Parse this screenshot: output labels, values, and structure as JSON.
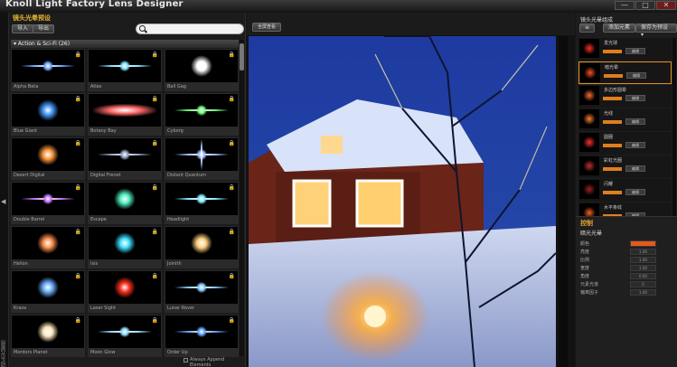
{
  "window": {
    "title": "Knoll Light Factory Lens Designer",
    "min_label": "—",
    "max_label": "□",
    "close_label": "✕"
  },
  "left_tab": {
    "label": "镜头光晕预设"
  },
  "library": {
    "title": "镜头光晕预设",
    "import_label": "导入",
    "export_label": "导出",
    "category": "▾ Action & Sci-Fi (26)",
    "append_label": "Always Append Elements",
    "presets": [
      {
        "name": "Alpha Beta",
        "color": "#6fa8ff",
        "style": "streak"
      },
      {
        "name": "Atlas",
        "color": "#7fe0ff",
        "style": "streak"
      },
      {
        "name": "Ball Gag",
        "color": "#ffffff",
        "style": "orb"
      },
      {
        "name": "Blue Giant",
        "color": "#4a9aff",
        "style": "orb"
      },
      {
        "name": "Botany Bay",
        "color": "#ff6a6a",
        "style": "bar"
      },
      {
        "name": "Cyborg",
        "color": "#6bff7a",
        "style": "streak"
      },
      {
        "name": "Desert Digital",
        "color": "#ff9a40",
        "style": "orb"
      },
      {
        "name": "Digital Frenet",
        "color": "#8fa0c0",
        "style": "streak"
      },
      {
        "name": "Distant Quantum",
        "color": "#9fb8ff",
        "style": "star"
      },
      {
        "name": "Double Barrel",
        "color": "#c070ff",
        "style": "streak"
      },
      {
        "name": "Escape",
        "color": "#50f0c0",
        "style": "orb"
      },
      {
        "name": "Headlight",
        "color": "#7fe8ff",
        "style": "streak"
      },
      {
        "name": "Helion",
        "color": "#ff9050",
        "style": "orb"
      },
      {
        "name": "Isis",
        "color": "#40e0ff",
        "style": "orb"
      },
      {
        "name": "Joinlth",
        "color": "#ffd080",
        "style": "orb"
      },
      {
        "name": "Kraza",
        "color": "#6fb0ff",
        "style": "orb"
      },
      {
        "name": "Laser Sight",
        "color": "#ff3020",
        "style": "orb"
      },
      {
        "name": "Lunar Rover",
        "color": "#80c8ff",
        "style": "streak"
      },
      {
        "name": "Mordors Planet",
        "color": "#ffe8c0",
        "style": "orb"
      },
      {
        "name": "Moon Glow",
        "color": "#8fd8ff",
        "style": "streak"
      },
      {
        "name": "Order Up",
        "color": "#60a0ff",
        "style": "streak"
      }
    ]
  },
  "viewer": {
    "button_label": "全屏查看"
  },
  "controls": {
    "title": "镜头光晕组成",
    "btn1": "≡",
    "btn2": "添加元素",
    "btn3": "保存为预设 ▾",
    "elements": [
      {
        "name": "发光球",
        "color": "#ff3020"
      },
      {
        "name": "暗光晕",
        "color": "#ff5020"
      },
      {
        "name": "多边形圆晕",
        "color": "#ff6a30"
      },
      {
        "name": "光线",
        "color": "#ff8030"
      },
      {
        "name": "圆圈",
        "color": "#ff3030"
      },
      {
        "name": "彩虹光圈",
        "color": "#c03030"
      },
      {
        "name": "闪耀",
        "color": "#a02020"
      },
      {
        "name": "水平条纹",
        "color": "#ff6020"
      }
    ],
    "element_button": "编辑"
  },
  "props": {
    "title": "控制",
    "subtitle": "暗光光晕",
    "rows": [
      {
        "label": "颜色",
        "value": ""
      },
      {
        "label": "亮度",
        "value": "1.00"
      },
      {
        "label": "比例",
        "value": "1.00"
      },
      {
        "label": "宽度",
        "value": "1.00"
      },
      {
        "label": "角度",
        "value": "0.00"
      },
      {
        "label": "元素光谱",
        "value": "0"
      },
      {
        "label": "偏离因子",
        "value": "1.00"
      }
    ]
  }
}
